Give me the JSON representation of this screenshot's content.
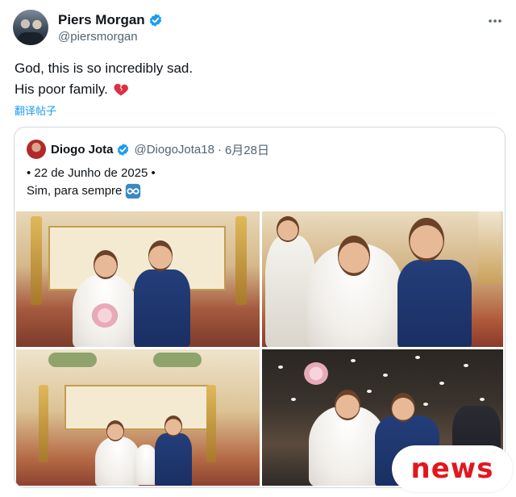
{
  "tweet": {
    "author": {
      "display_name": "Piers Morgan",
      "handle": "@piersmorgan",
      "verified": true
    },
    "menu_icon": "more-icon",
    "lines": [
      "God, this is so incredibly sad.",
      "His poor family."
    ],
    "emoji": "broken-heart-icon",
    "translate_label": "翻译帖子"
  },
  "quoted": {
    "author": {
      "display_name": "Diogo Jota",
      "handle": "@DiogoJota18",
      "verified": true
    },
    "separator": "·",
    "date": "6月28日",
    "lines": [
      "• 22 de Junho de 2025 •",
      "Sim, para sempre"
    ],
    "emoji": "infinity-icon",
    "photos": [
      "wedding-photo-altar",
      "wedding-photo-ring",
      "wedding-photo-family",
      "wedding-photo-exit"
    ]
  },
  "overlay": {
    "badge_text": "news",
    "badge_color": "#e4161c"
  },
  "colors": {
    "accent": "#1d9bf0",
    "text": "#0f1419",
    "muted": "#536471",
    "border": "#cfd9de"
  }
}
